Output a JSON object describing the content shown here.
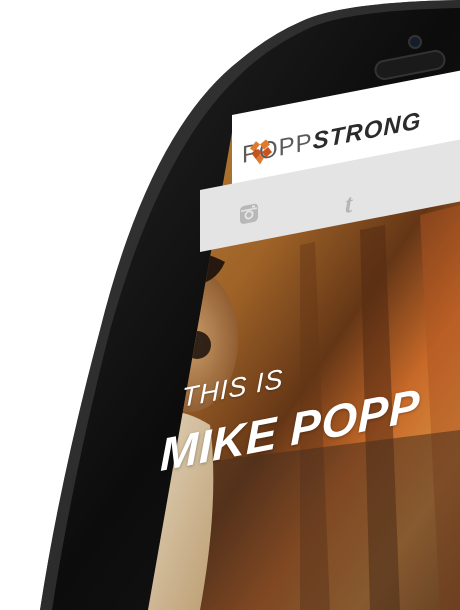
{
  "logo": {
    "left_text": "POPP",
    "right_text": "STRONG",
    "mark_colors": [
      "#e07a2e",
      "#c8531e"
    ]
  },
  "nav": {
    "icons": [
      "instagram-icon",
      "tumblr-icon"
    ],
    "tumblr_glyph": "t"
  },
  "hero": {
    "line1": "THIS IS",
    "line2": "MIKE POPP"
  },
  "colors": {
    "phone_body": "#111111",
    "screen_bg": "#ffffff",
    "nav_bg": "#e3e3e3",
    "accent": "#e07a2e"
  }
}
